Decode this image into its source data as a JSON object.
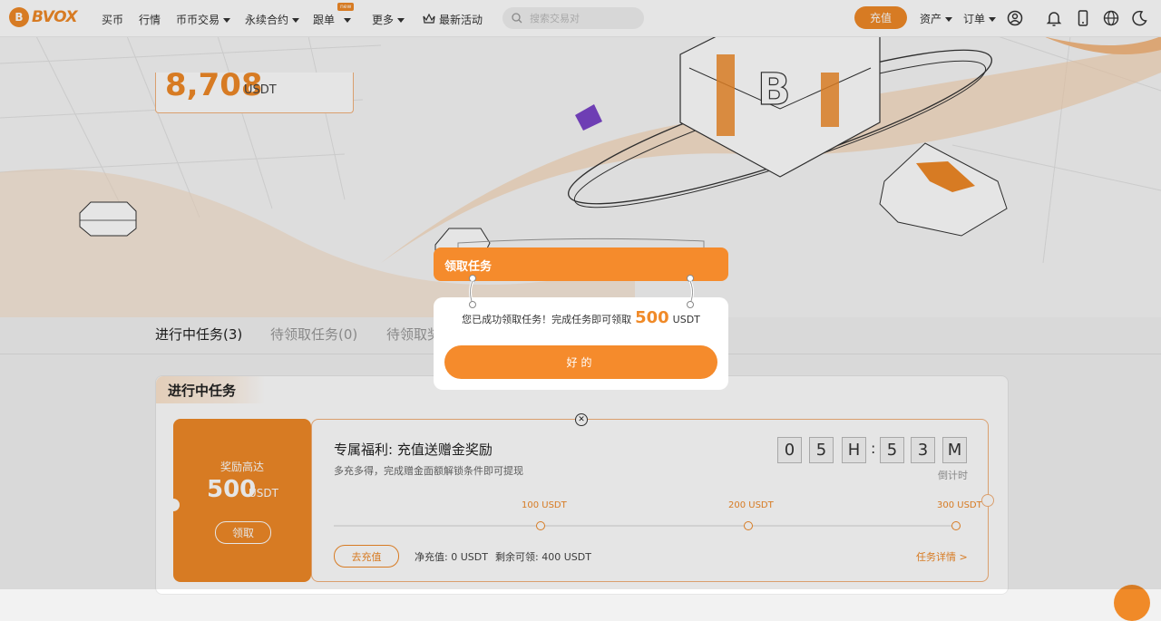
{
  "brand": {
    "logo_text": "BVOX",
    "accent": "#f08a28"
  },
  "nav": {
    "items": [
      {
        "label": "买币",
        "has_caret": false
      },
      {
        "label": "行情",
        "has_caret": false
      },
      {
        "label": "币币交易",
        "has_caret": true
      },
      {
        "label": "永续合约",
        "has_caret": true
      },
      {
        "label": "跟单",
        "has_caret": true
      },
      {
        "label": "更多",
        "has_caret": true
      },
      {
        "label": "最新活动",
        "has_caret": false
      }
    ],
    "new_badge": "new",
    "search_placeholder": "搜索交易对",
    "recharge_label": "充值",
    "assets_label": "资产",
    "orders_label": "订单"
  },
  "hero": {
    "balance_value": "8,708",
    "balance_unit": "USDT"
  },
  "tabs": [
    {
      "label": "进行中任务(3)",
      "active": true
    },
    {
      "label": "待领取任务(0)",
      "active": false
    },
    {
      "label": "待领取奖",
      "active": false
    }
  ],
  "section": {
    "title": "进行中任务"
  },
  "reward_card": {
    "label": "奖励高达",
    "amount": "500",
    "unit": "USDT",
    "claim_label": "领取"
  },
  "task": {
    "title": "专属福利: 充值送赠金奖励",
    "description": "多充多得，完成赠金面额解锁条件即可提现",
    "countdown_digits": [
      "0",
      "5",
      "H",
      "5",
      "3",
      "M"
    ],
    "countdown_colon": ":",
    "countdown_label": "倒计时",
    "milestones": [
      "100 USDT",
      "200 USDT",
      "300 USDT"
    ],
    "deposit_label": "去充值",
    "net_deposit": "净充值: 0 USDT",
    "remaining": "剩余可领: 400 USDT",
    "detail_label": "任务详情 >"
  },
  "modal": {
    "title": "领取任务",
    "message_before": "您已成功领取任务！完成任务即可领取",
    "amount": "500",
    "unit": "USDT",
    "ok_label": "好的"
  }
}
